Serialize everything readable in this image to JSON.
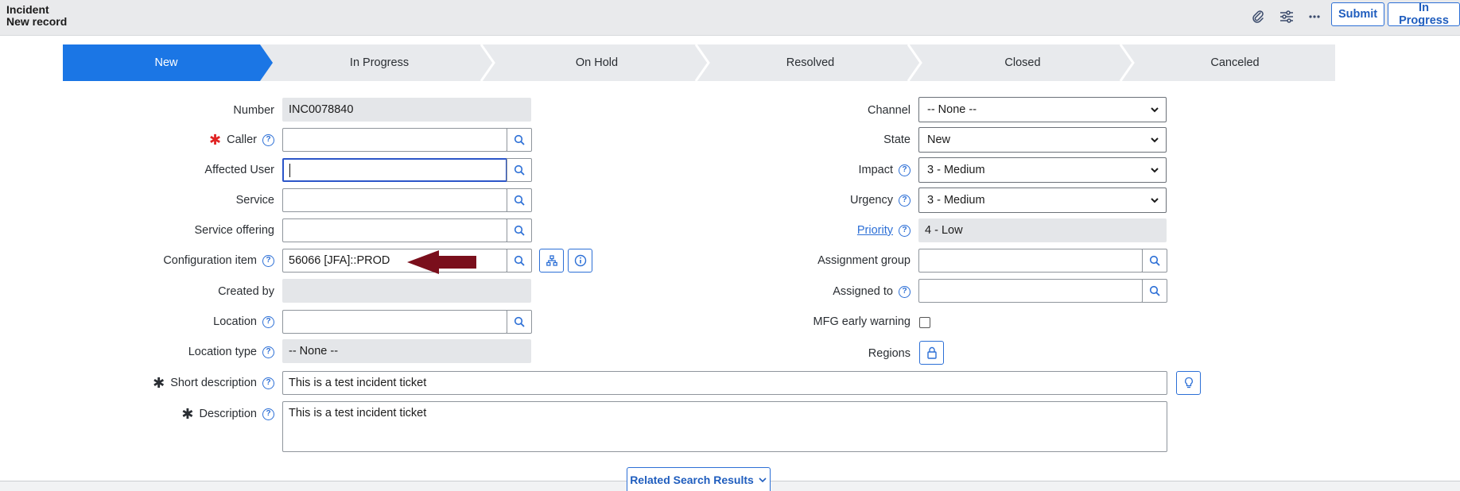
{
  "header": {
    "title": "Incident",
    "subtitle": "New record",
    "submit_label": "Submit",
    "in_progress_label": "In Progress",
    "icons": [
      "paperclip-icon",
      "settings-sliders-icon",
      "more-icon"
    ]
  },
  "stages": [
    "New",
    "In Progress",
    "On Hold",
    "Resolved",
    "Closed",
    "Canceled"
  ],
  "active_stage": "New",
  "colors": {
    "accent": "#1b76e5",
    "link": "#2c6fd6",
    "required": "#e02424",
    "arrow": "#7a0f1c"
  },
  "left": {
    "number_label": "Number",
    "number_value": "INC0078840",
    "caller_label": "Caller",
    "affected_user_label": "Affected User",
    "service_label": "Service",
    "service_offering_label": "Service offering",
    "config_item_label": "Configuration item",
    "config_item_value": "56066 [JFA]::PROD",
    "created_by_label": "Created by",
    "location_label": "Location",
    "location_type_label": "Location type",
    "location_type_value": "-- None --"
  },
  "right": {
    "channel_label": "Channel",
    "channel_value": "-- None --",
    "state_label": "State",
    "state_value": "New",
    "impact_label": "Impact",
    "impact_value": "3 - Medium",
    "urgency_label": "Urgency",
    "urgency_value": "3 - Medium",
    "priority_label": "Priority",
    "priority_value": "4 - Low",
    "assignment_group_label": "Assignment group",
    "assigned_to_label": "Assigned to",
    "mfg_label": "MFG early warning",
    "regions_label": "Regions"
  },
  "full": {
    "short_desc_label": "Short description",
    "short_desc_value": "This is a test incident ticket",
    "description_label": "Description",
    "description_value": "This is a test incident ticket"
  },
  "related_label": "Related Search Results"
}
